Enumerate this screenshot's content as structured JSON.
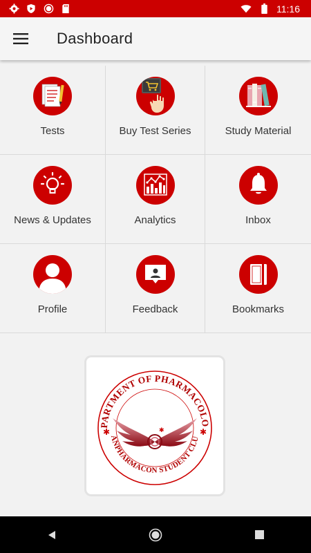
{
  "status_bar": {
    "time": "11:16",
    "left_icons": [
      "gear-icon",
      "shield-icon",
      "record-icon",
      "sd-card-icon"
    ],
    "right_icons": [
      "wifi-icon",
      "battery-icon"
    ]
  },
  "app_bar": {
    "title": "Dashboard",
    "menu_icon": "hamburger-menu-icon"
  },
  "dashboard": {
    "tiles": [
      {
        "label": "Tests",
        "icon": "test-sheets-icon"
      },
      {
        "label": "Buy Test Series",
        "icon": "shopping-cart-icon"
      },
      {
        "label": "Study Material",
        "icon": "books-icon"
      },
      {
        "label": "News & Updates",
        "icon": "lightbulb-icon"
      },
      {
        "label": "Analytics",
        "icon": "analytics-chart-icon"
      },
      {
        "label": "Inbox",
        "icon": "bell-icon"
      },
      {
        "label": "Profile",
        "icon": "person-icon"
      },
      {
        "label": "Feedback",
        "icon": "feedback-icon"
      },
      {
        "label": "Bookmarks",
        "icon": "bookmark-icon"
      }
    ]
  },
  "logo": {
    "top_text": "DEPARTMENT OF PHARMACOLOGY",
    "bottom_text": "PANPHARMACON STUDENT CLUB"
  },
  "nav_bar": {
    "icons": [
      "back-icon",
      "home-icon",
      "recents-icon"
    ]
  },
  "colors": {
    "primary_red": "#cc0000",
    "background": "#f2f2f2"
  }
}
